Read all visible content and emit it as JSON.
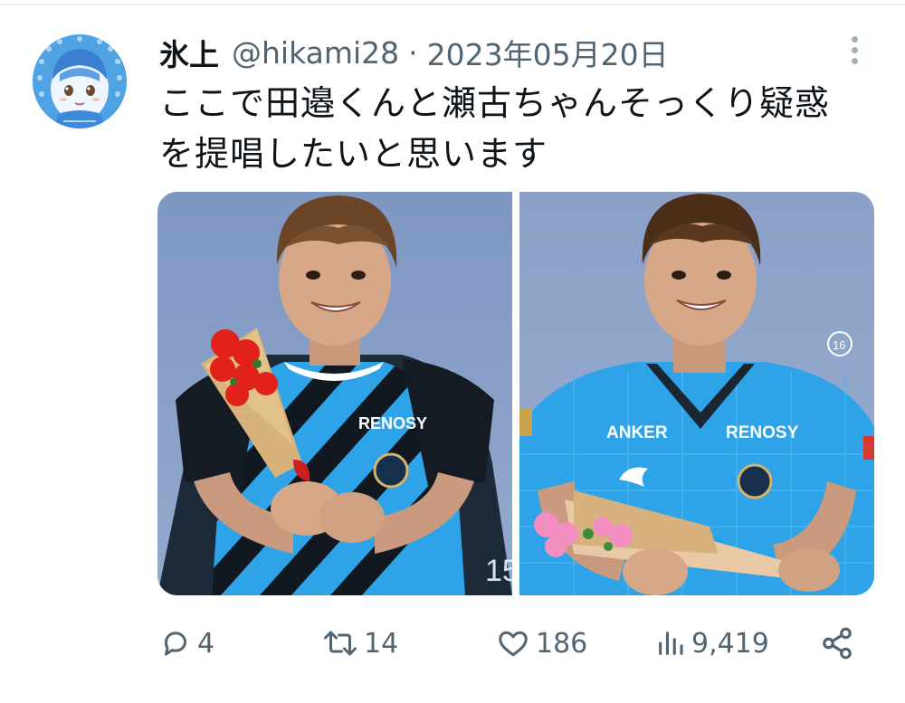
{
  "tweet": {
    "display_name": "氷上",
    "handle": "@hikami28",
    "separator": "·",
    "date": "2023年05月20日",
    "text_line1": "ここで田邉くんと瀬古ちゃんそっくり疑惑",
    "text_line2": "を提唱したいと思います"
  },
  "media": {
    "left": {
      "jersey_text": "RENOSY",
      "number": "15"
    },
    "right": {
      "sponsor_left": "ANKER",
      "sponsor_right": "RENOSY",
      "number": "16"
    }
  },
  "actions": {
    "reply_count": "4",
    "retweet_count": "14",
    "like_count": "186",
    "view_count": "9,419"
  },
  "icons": {
    "reply": "reply-icon",
    "retweet": "retweet-icon",
    "like": "heart-icon",
    "views": "views-icon",
    "share": "share-icon",
    "more": "more-vertical-icon"
  },
  "colors": {
    "text": "#0f1419",
    "muted": "#536471",
    "jersey_blue": "#2ea3e8",
    "jersey_dark": "#101418"
  }
}
